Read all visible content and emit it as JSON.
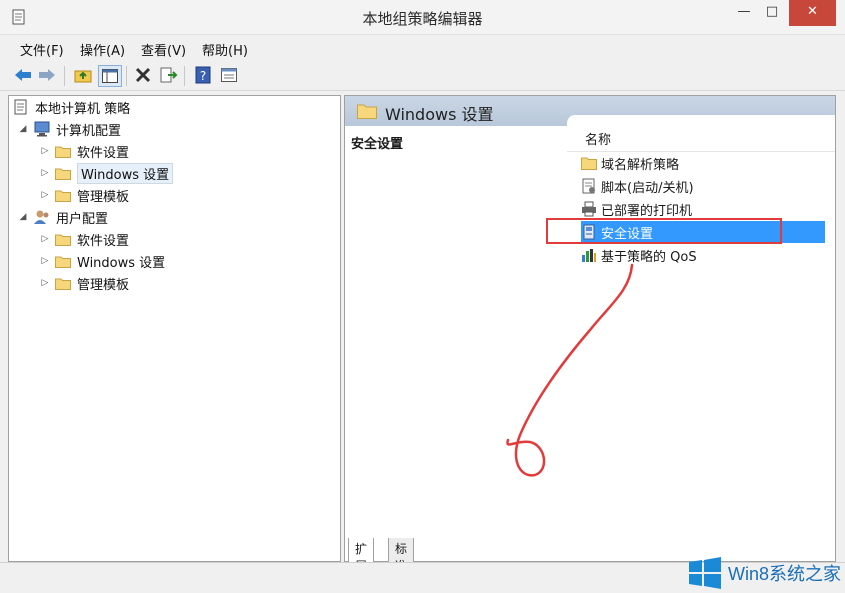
{
  "window": {
    "title": "本地组策略编辑器",
    "min_icon": "minimize-icon",
    "max_icon": "maximize-icon",
    "close_icon": "close-icon"
  },
  "menu": {
    "items": [
      "文件(F)",
      "操作(A)",
      "查看(V)",
      "帮助(H)"
    ]
  },
  "toolbar": {
    "icons": [
      "back-arrow-icon",
      "forward-arrow-icon",
      "up-folder-icon",
      "show-hide-tree-icon",
      "delete-icon",
      "export-list-icon",
      "help-icon",
      "properties-icon"
    ]
  },
  "tree": {
    "root": "本地计算机 策略",
    "computer_config": "计算机配置",
    "computer_children": [
      "软件设置",
      "Windows 设置",
      "管理模板"
    ],
    "user_config": "用户配置",
    "user_children": [
      "软件设置",
      "Windows 设置",
      "管理模板"
    ]
  },
  "right": {
    "header": "Windows 设置",
    "section_title": "安全设置",
    "column_name": "名称",
    "items": [
      {
        "label": "域名解析策略",
        "icon": "folder-icon"
      },
      {
        "label": "脚本(启动/关机)",
        "icon": "script-icon"
      },
      {
        "label": "已部署的打印机",
        "icon": "printer-icon"
      },
      {
        "label": "安全设置",
        "icon": "security-icon",
        "selected": true
      },
      {
        "label": "基于策略的 QoS",
        "icon": "bar-chart-icon"
      }
    ]
  },
  "tabs": [
    "扩展",
    "标准"
  ],
  "watermark": {
    "text": "Win8系统之家"
  },
  "colors": {
    "selection": "#3399ff",
    "annotation": "#e23b3b",
    "close": "#c7483b",
    "header": "#c9d6e5"
  }
}
